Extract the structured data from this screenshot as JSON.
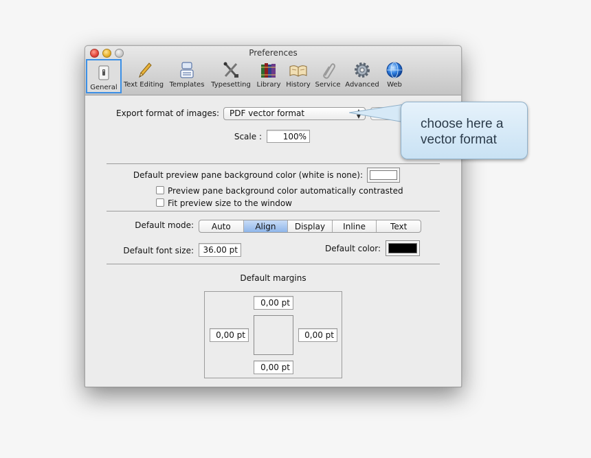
{
  "window": {
    "title": "Preferences"
  },
  "toolbar": {
    "items": [
      {
        "label": "General",
        "icon": "general-switch-icon"
      },
      {
        "label": "Text Editing",
        "icon": "pencil-icon"
      },
      {
        "label": "Templates",
        "icon": "templates-icon"
      },
      {
        "label": "Typesetting",
        "icon": "typesetting-tools-icon"
      },
      {
        "label": "Library",
        "icon": "books-icon"
      },
      {
        "label": "History",
        "icon": "open-book-icon"
      },
      {
        "label": "Service",
        "icon": "paperclip-icon"
      },
      {
        "label": "Advanced",
        "icon": "gear-icon"
      },
      {
        "label": "Web",
        "icon": "globe-icon"
      }
    ],
    "selected": "General"
  },
  "export": {
    "label": "Export format of images:",
    "value": "PDF vector format"
  },
  "scale": {
    "label": "Scale :",
    "value": "100%"
  },
  "preview": {
    "bg_label": "Default preview pane background color (white is none):",
    "bg_color": "#ffffff",
    "check_contrast": "Preview pane background color automatically contrasted",
    "check_fit": "Fit preview size to the window"
  },
  "mode": {
    "label": "Default mode:",
    "options": [
      "Auto",
      "Align",
      "Display",
      "Inline",
      "Text"
    ],
    "selected": "Align"
  },
  "font": {
    "size_label": "Default font size:",
    "size_value": "36.00 pt",
    "color_label": "Default color:",
    "color": "#000000"
  },
  "margins": {
    "label": "Default margins",
    "top": "0,00 pt",
    "left": "0,00 pt",
    "right": "0,00 pt",
    "bottom": "0,00 pt"
  },
  "callout": {
    "text": "choose here a vector format"
  },
  "colors": {
    "selection_border": "#3b8fe5",
    "segment_selected": "#8fb6ea"
  }
}
